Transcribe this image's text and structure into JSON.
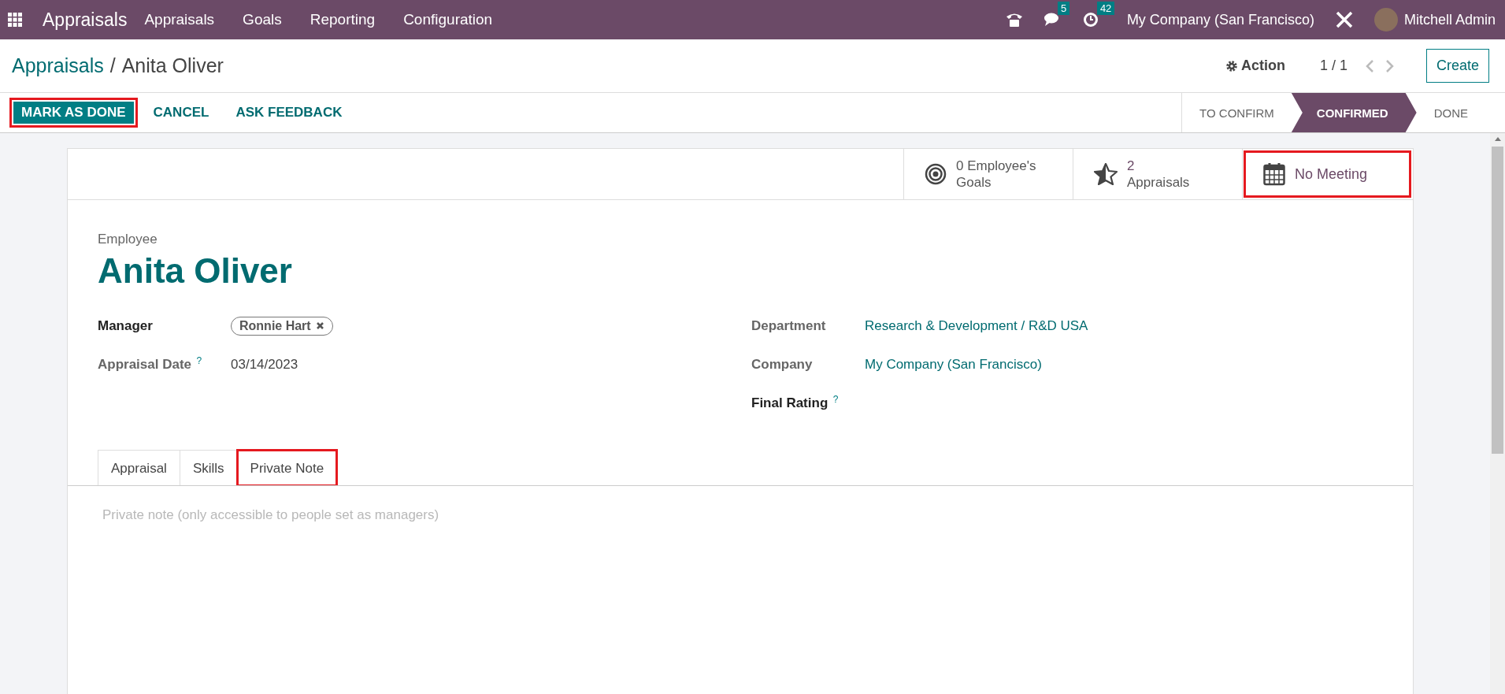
{
  "navbar": {
    "app_name": "Appraisals",
    "menu": [
      "Appraisals",
      "Goals",
      "Reporting",
      "Configuration"
    ],
    "messages_count": "5",
    "activities_count": "42",
    "company": "My Company (San Francisco)",
    "user": "Mitchell Admin"
  },
  "breadcrumb": {
    "parent": "Appraisals",
    "separator": "/",
    "current": "Anita Oliver"
  },
  "control_panel": {
    "action": "Action",
    "pager": "1 / 1",
    "create": "Create"
  },
  "buttons": [
    {
      "label": "MARK AS DONE",
      "kind": "primary",
      "highlighted": true
    },
    {
      "label": "CANCEL",
      "kind": "link",
      "highlighted": false
    },
    {
      "label": "ASK FEEDBACK",
      "kind": "link",
      "highlighted": false
    }
  ],
  "statusbar": [
    {
      "label": "TO CONFIRM",
      "selected": false
    },
    {
      "label": "CONFIRMED",
      "selected": true
    },
    {
      "label": "DONE",
      "selected": false
    }
  ],
  "smart_buttons": [
    {
      "kind": "goals",
      "lines": [
        "0 Employee's",
        "Goals"
      ],
      "highlighted": false
    },
    {
      "kind": "appraisals",
      "lines": [
        "2",
        "Appraisals"
      ],
      "highlighted": false
    },
    {
      "kind": "meeting",
      "lines": [
        "No Meeting"
      ],
      "highlighted": true
    }
  ],
  "employee_label": "Employee",
  "employee_name": "Anita Oliver",
  "left_fields": [
    {
      "label": "Manager",
      "kind": "tag",
      "value": "Ronnie Hart",
      "help": false,
      "bold": true
    },
    {
      "label": "Appraisal Date",
      "kind": "text",
      "value": "03/14/2023",
      "help": true,
      "bold": false
    }
  ],
  "right_fields": [
    {
      "label": "Department",
      "kind": "link",
      "value": "Research & Development / R&D USA",
      "help": false,
      "bold": false
    },
    {
      "label": "Company",
      "kind": "link",
      "value": "My Company (San Francisco)",
      "help": false,
      "bold": false
    },
    {
      "label": "Final Rating",
      "kind": "empty",
      "help": true,
      "bold": true
    }
  ],
  "help_mark": "?",
  "tabs": [
    {
      "label": "Appraisal",
      "selected": false,
      "highlighted": false
    },
    {
      "label": "Skills",
      "selected": false,
      "highlighted": false
    },
    {
      "label": "Private Note",
      "selected": true,
      "highlighted": true
    }
  ],
  "note": {
    "placeholder": "Private note (only accessible to people set as managers)"
  }
}
